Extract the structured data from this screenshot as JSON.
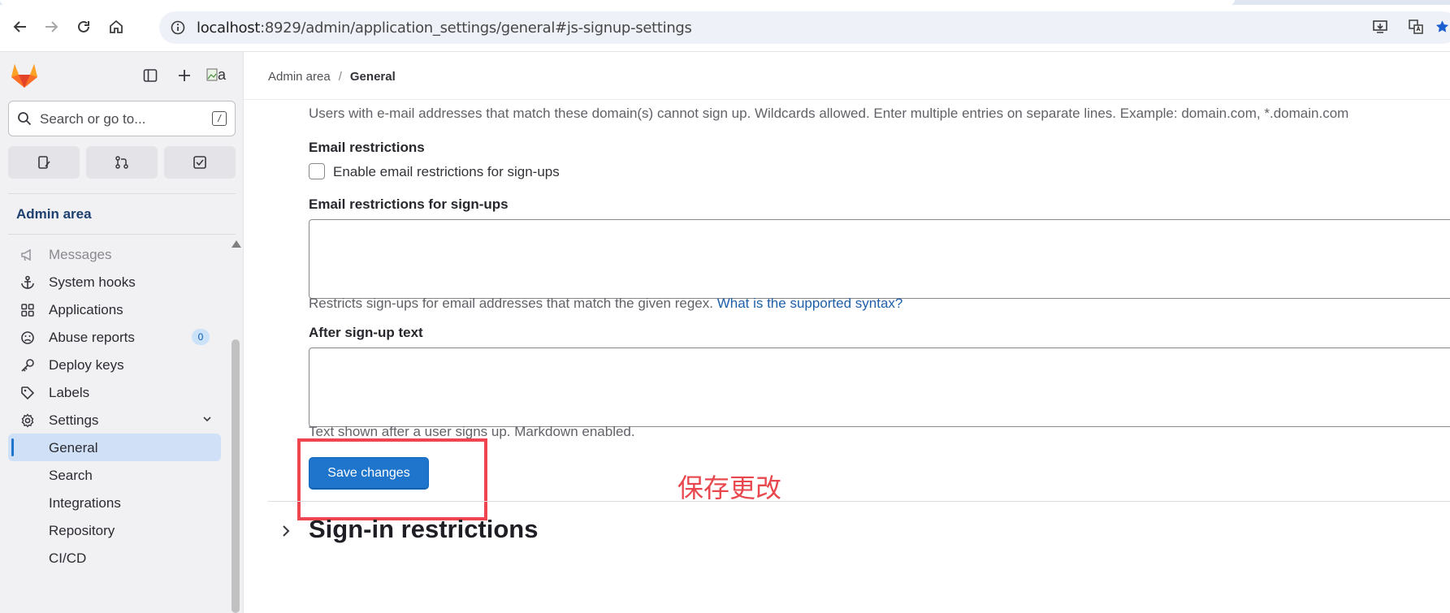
{
  "browser": {
    "url_host": "localhost",
    "url_rest": ":8929/admin/application_settings/general#js-signup-settings"
  },
  "sidebar": {
    "avatar_alt": "a",
    "search_placeholder": "Search or go to...",
    "search_shortcut": "/",
    "context_title": "Admin area",
    "items": [
      {
        "label": "Messages",
        "icon": "megaphone-icon"
      },
      {
        "label": "System hooks",
        "icon": "anchor-icon"
      },
      {
        "label": "Applications",
        "icon": "apps-grid-icon"
      },
      {
        "label": "Abuse reports",
        "icon": "sad-face-icon",
        "badge": "0"
      },
      {
        "label": "Deploy keys",
        "icon": "key-icon"
      },
      {
        "label": "Labels",
        "icon": "label-tag-icon"
      },
      {
        "label": "Settings",
        "icon": "gear-icon",
        "expanded": true
      },
      {
        "label": "General",
        "active": true
      },
      {
        "label": "Search"
      },
      {
        "label": "Integrations"
      },
      {
        "label": "Repository"
      },
      {
        "label": "CI/CD"
      }
    ]
  },
  "breadcrumb": {
    "parent": "Admin area",
    "separator": "/",
    "current": "General"
  },
  "form": {
    "denylist_help": "Users with e-mail addresses that match these domain(s) cannot sign up. Wildcards allowed. Enter multiple entries on separate lines. Example: domain.com, *.domain.com",
    "email_restrictions_label": "Email restrictions",
    "email_restrictions_checkbox": "Enable email restrictions for sign-ups",
    "email_restrictions_field_label": "Email restrictions for sign-ups",
    "email_restrictions_field_value": "",
    "email_restrictions_help": "Restricts sign-ups for email addresses that match the given regex.",
    "email_restrictions_help_link": "What is the supported syntax?",
    "after_signup_label": "After sign-up text",
    "after_signup_value": "",
    "after_signup_help": "Text shown after a user signs up. Markdown enabled.",
    "save_button": "Save changes",
    "annotation": "保存更改"
  },
  "next_section": {
    "title": "Sign-in restrictions"
  },
  "colors": {
    "primary_button": "#1f75cb",
    "highlight_box": "#ee4550",
    "active_nav_bg": "#cfe0f7",
    "link": "#1f5fa8"
  }
}
